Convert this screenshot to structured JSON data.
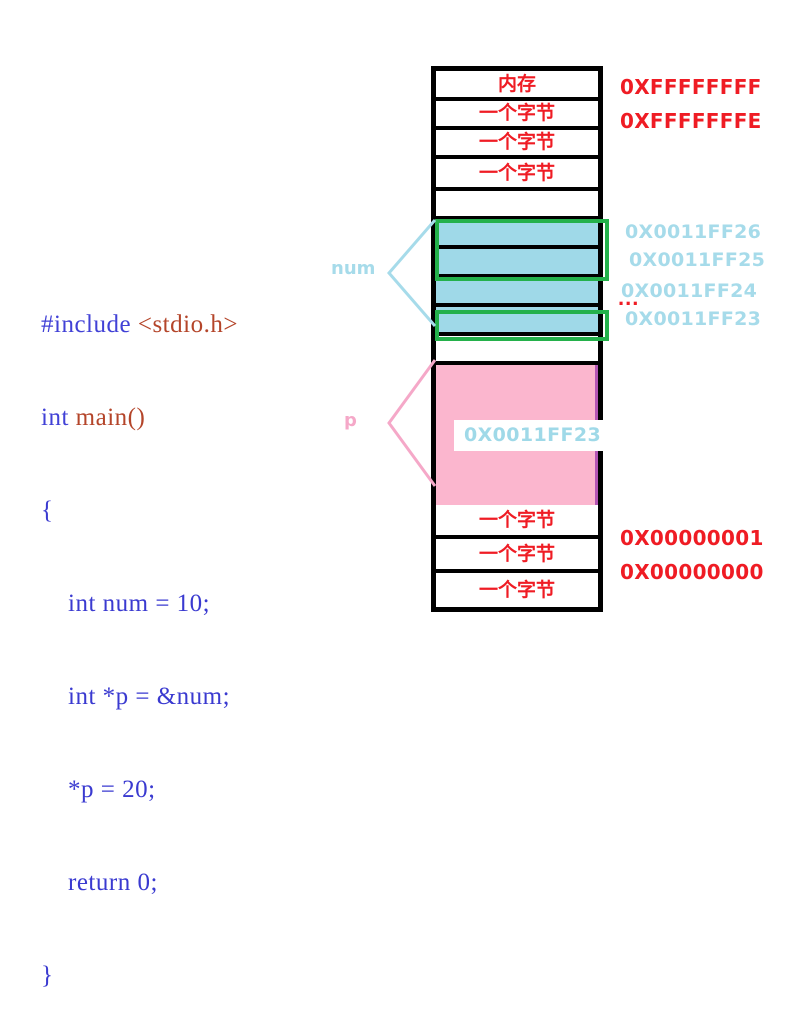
{
  "code": {
    "lines": [
      {
        "id": "l1",
        "segments": [
          {
            "text": "#include ",
            "cls": "pre"
          },
          {
            "text": "<stdio.h>",
            "cls": "hdr"
          }
        ]
      },
      {
        "id": "l2",
        "segments": [
          {
            "text": "int ",
            "cls": "kw"
          },
          {
            "text": "main()",
            "cls": "fn"
          }
        ]
      },
      {
        "id": "l3",
        "segments": [
          {
            "text": "{",
            "cls": "plain"
          }
        ]
      },
      {
        "id": "l4",
        "segments": [
          {
            "text": "    int num = 10;",
            "cls": "plain"
          }
        ]
      },
      {
        "id": "l5",
        "segments": [
          {
            "text": "    int *p = &num;",
            "cls": "plain"
          }
        ]
      },
      {
        "id": "l6",
        "segments": [
          {
            "text": "    *p = 20;",
            "cls": "plain"
          }
        ]
      },
      {
        "id": "l7",
        "segments": [
          {
            "text": "    return 0;",
            "cls": "plain"
          }
        ]
      },
      {
        "id": "l8",
        "segments": [
          {
            "text": "}",
            "cls": "plain"
          }
        ]
      }
    ],
    "full_text": "#include <stdio.h>\nint main()\n{\n    int num = 10;\n    int *p = &num;\n    *p = 20;\n    return 0;\n}"
  },
  "memory_table": {
    "rows": [
      {
        "label": "内存",
        "kind": "header"
      },
      {
        "label": "一个字节",
        "kind": "byte"
      },
      {
        "label": "一个字节",
        "kind": "byte"
      },
      {
        "label": "一个字节",
        "kind": "byte"
      },
      {
        "label": "",
        "kind": "blank"
      },
      {
        "label": "",
        "kind": "cyan"
      },
      {
        "label": "",
        "kind": "cyan"
      },
      {
        "label": "",
        "kind": "cyan"
      },
      {
        "label": "",
        "kind": "cyan"
      },
      {
        "label": "",
        "kind": "blank"
      },
      {
        "label": "0X0011FF23",
        "kind": "pink"
      },
      {
        "label": "一个字节",
        "kind": "byte"
      },
      {
        "label": "一个字节",
        "kind": "byte"
      },
      {
        "label": "一个字节",
        "kind": "byte"
      }
    ],
    "header_label": "内存",
    "byte_label": "一个字节",
    "pointer_value": "0X0011FF23"
  },
  "address_labels": {
    "top": [
      {
        "text": "0XFFFFFFFF",
        "color": "#ef1c24"
      },
      {
        "text": "0XFFFFFFFE",
        "color": "#ef1c24"
      }
    ],
    "middle": [
      {
        "text": "0X0011FF26",
        "color": "#a6dbea"
      },
      {
        "text": "0X0011FF25",
        "color": "#a6dbea"
      },
      {
        "text": "0X0011FF24",
        "color": "#a6dbea"
      },
      {
        "text": "0X0011FF23",
        "color": "#a6dbea"
      }
    ],
    "bottom": [
      {
        "text": "0X00000001",
        "color": "#ef1c24"
      },
      {
        "text": "0X00000000",
        "color": "#ef1c24"
      }
    ],
    "ellipsis": "..."
  },
  "variables": {
    "num_label": "num",
    "p_label": "p"
  },
  "colors": {
    "memory_red": "#ef1c24",
    "cyan_fill": "#9fd9e8",
    "cyan_text": "#a6dbea",
    "green_outline": "#24b14b",
    "pink_fill": "#fbb6ce",
    "pink_text": "#f5a8c8",
    "purple_border": "#b455b4",
    "code_blue": "#3a3ad0",
    "code_brown": "#b4452a"
  }
}
